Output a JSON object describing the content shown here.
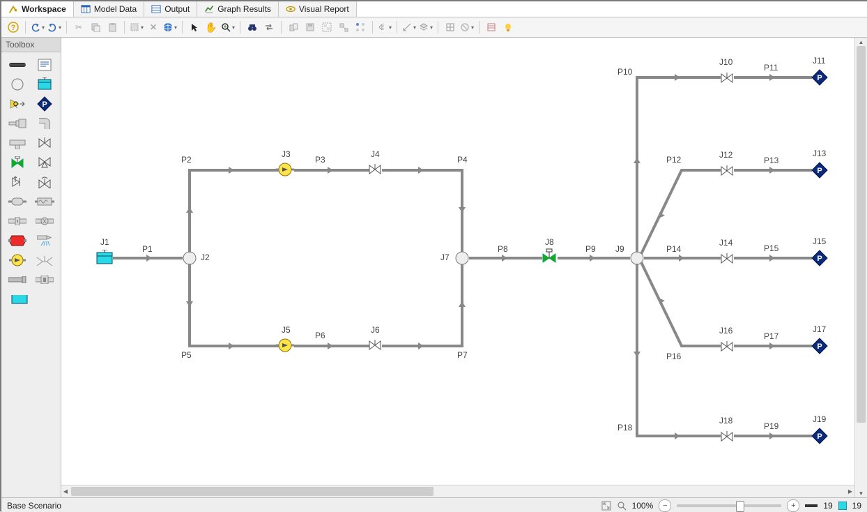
{
  "tabs": [
    "Workspace",
    "Model Data",
    "Output",
    "Graph Results",
    "Visual Report"
  ],
  "active_tab": 0,
  "toolbox_title": "Toolbox",
  "status": {
    "scenario": "Base Scenario",
    "zoom": "100%",
    "pipe_count": "19",
    "jct_count": "19"
  },
  "junctions": {
    "J1": "J1",
    "J2": "J2",
    "J3": "J3",
    "J4": "J4",
    "J5": "J5",
    "J6": "J6",
    "J7": "J7",
    "J8": "J8",
    "J9": "J9",
    "J10": "J10",
    "J11": "J11",
    "J12": "J12",
    "J13": "J13",
    "J14": "J14",
    "J15": "J15",
    "J16": "J16",
    "J17": "J17",
    "J18": "J18",
    "J19": "J19"
  },
  "pipes": {
    "P1": "P1",
    "P2": "P2",
    "P3": "P3",
    "P4": "P4",
    "P5": "P5",
    "P6": "P6",
    "P7": "P7",
    "P8": "P8",
    "P9": "P9",
    "P10": "P10",
    "P11": "P11",
    "P12": "P12",
    "P13": "P13",
    "P14": "P14",
    "P15": "P15",
    "P16": "P16",
    "P17": "P17",
    "P18": "P18",
    "P19": "P19"
  }
}
